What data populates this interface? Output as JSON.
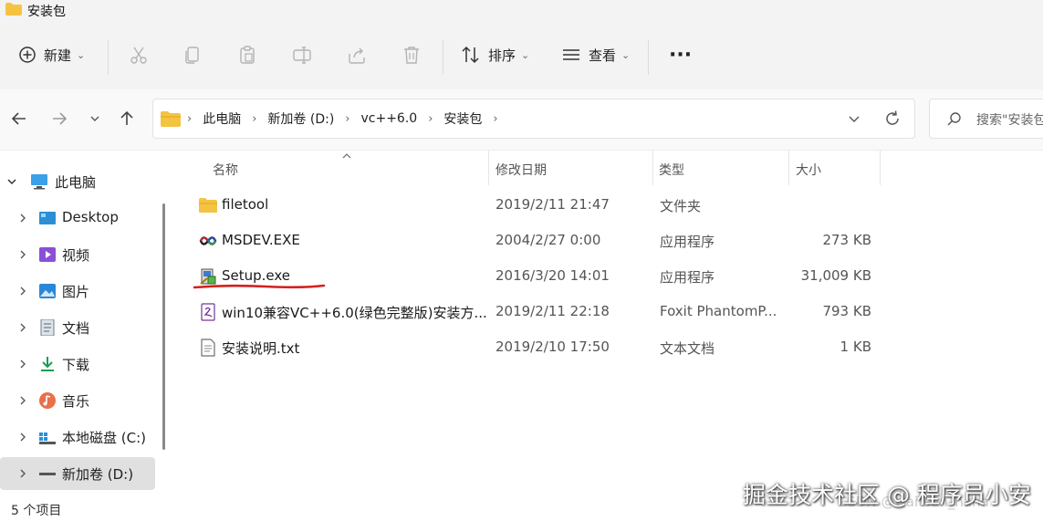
{
  "window": {
    "title": "安装包"
  },
  "toolbar": {
    "new_label": "新建",
    "sort_label": "排序",
    "view_label": "查看",
    "more_label": "···"
  },
  "nav": {
    "breadcrumb": [
      "此电脑",
      "新加卷 (D:)",
      "vc++6.0",
      "安装包"
    ],
    "search_placeholder": "搜索\"安装包\""
  },
  "sidebar": {
    "items": [
      {
        "label": "此电脑",
        "icon": "monitor-icon"
      },
      {
        "label": "Desktop",
        "icon": "desktop-icon"
      },
      {
        "label": "视频",
        "icon": "video-icon"
      },
      {
        "label": "图片",
        "icon": "picture-icon"
      },
      {
        "label": "文档",
        "icon": "document-icon"
      },
      {
        "label": "下载",
        "icon": "download-icon"
      },
      {
        "label": "音乐",
        "icon": "music-icon"
      },
      {
        "label": "本地磁盘 (C:)",
        "icon": "drive-icon"
      },
      {
        "label": "新加卷 (D:)",
        "icon": "drive-icon"
      }
    ]
  },
  "columns": {
    "name": "名称",
    "date": "修改日期",
    "type": "类型",
    "size": "大小"
  },
  "files": [
    {
      "name": "filetool",
      "date": "2019/2/11 21:47",
      "type": "文件夹",
      "size": "",
      "icon": "folder-icon"
    },
    {
      "name": "MSDEV.EXE",
      "date": "2004/2/27 0:00",
      "type": "应用程序",
      "size": "273 KB",
      "icon": "msdev-icon"
    },
    {
      "name": "Setup.exe",
      "date": "2016/3/20 14:01",
      "type": "应用程序",
      "size": "31,009 KB",
      "icon": "setup-icon"
    },
    {
      "name": "win10兼容VC++6.0(绿色完整版)安装方...",
      "date": "2019/2/11 22:18",
      "type": "Foxit PhantomP...",
      "size": "793 KB",
      "icon": "pdf-icon"
    },
    {
      "name": "安装说明.txt",
      "date": "2019/2/10 17:50",
      "type": "文本文档",
      "size": "1 KB",
      "icon": "text-file-icon"
    }
  ],
  "status": {
    "item_count": "5 个项目"
  },
  "watermark": {
    "primary": "掘金技术社区 @ 程序员小安",
    "secondary": "CSDN @waitsun_nana"
  },
  "colors": {
    "accent": "#0067c0",
    "folder": "#f5c342",
    "annotation_underline": "#d42020"
  }
}
